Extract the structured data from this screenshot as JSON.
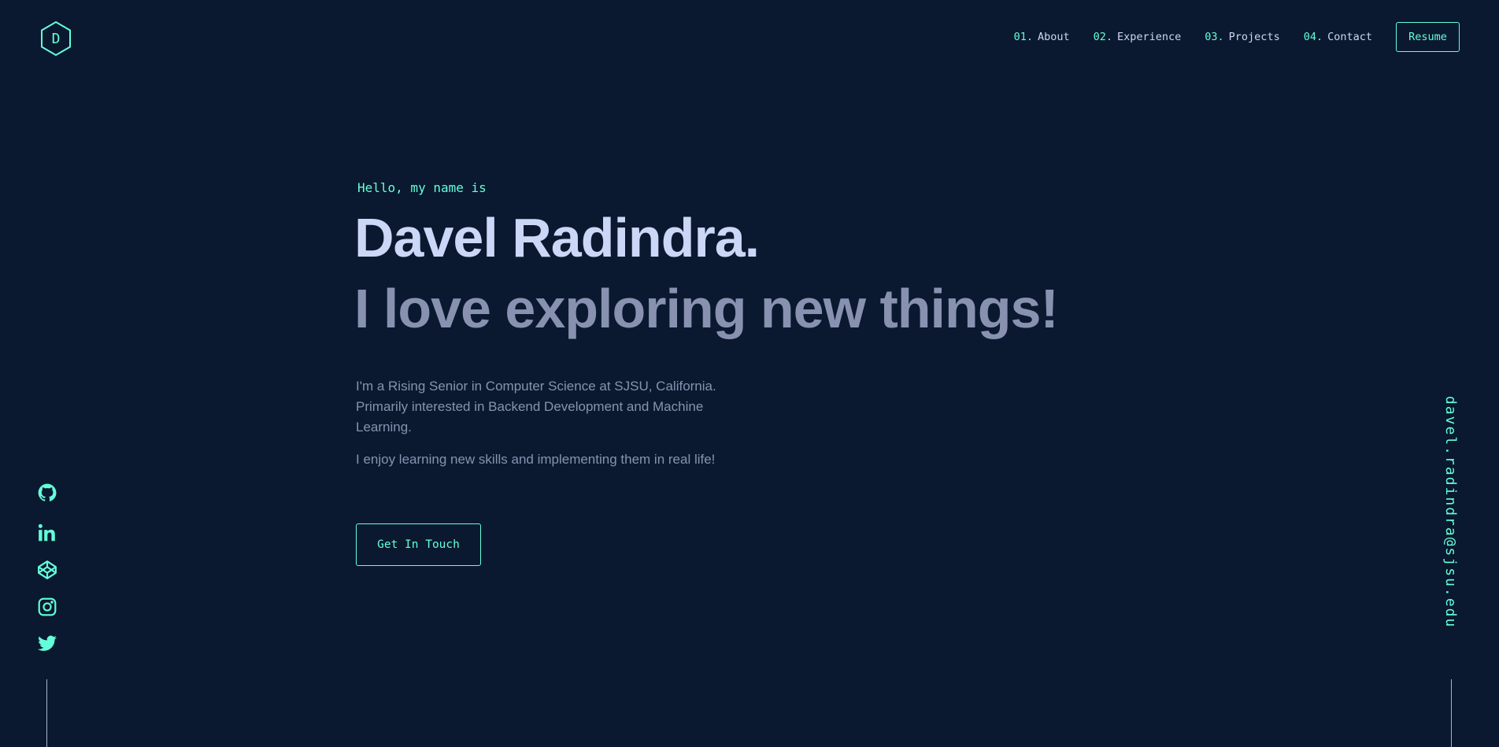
{
  "logo": {
    "letter": "D"
  },
  "nav": {
    "items": [
      {
        "num": "01.",
        "label": "About"
      },
      {
        "num": "02.",
        "label": "Experience"
      },
      {
        "num": "03.",
        "label": "Projects"
      },
      {
        "num": "04.",
        "label": "Contact"
      }
    ],
    "resume_label": "Resume"
  },
  "hero": {
    "greeting": "Hello, my name is",
    "name": "Davel Radindra.",
    "tagline": "I love exploring new things!",
    "bio": [
      "I'm a Rising Senior in Computer Science at SJSU, California. Primarily interested in Backend Development and Machine Learning.",
      "I enjoy learning new skills and implementing them in real life!"
    ],
    "cta_label": "Get In Touch"
  },
  "social": {
    "icons": [
      "github-icon",
      "linkedin-icon",
      "codepen-icon",
      "instagram-icon",
      "twitter-icon"
    ]
  },
  "email": "davel.radindra@sjsu.edu",
  "colors": {
    "background": "#0a192f",
    "accent": "#64ffda",
    "heading": "#ccd6f6",
    "text": "#8892b0"
  }
}
